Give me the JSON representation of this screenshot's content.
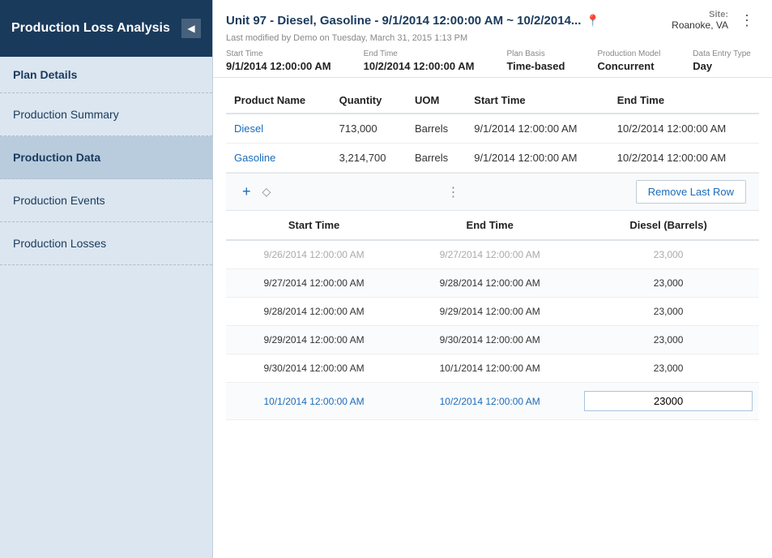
{
  "sidebar": {
    "title": "Production Loss Analysis",
    "plan_details_label": "Plan Details",
    "items": [
      {
        "id": "production-summary",
        "label": "Production Summary",
        "active": false
      },
      {
        "id": "production-data",
        "label": "Production Data",
        "active": true
      },
      {
        "id": "production-events",
        "label": "Production Events",
        "active": false
      },
      {
        "id": "production-losses",
        "label": "Production Losses",
        "active": false
      }
    ]
  },
  "header": {
    "title": "Unit 97 - Diesel, Gasoline - 9/1/2014 12:00:00 AM ~ 10/2/2014...",
    "subtitle": "Last modified by Demo on Tuesday, March 31, 2015 1:13 PM",
    "site_label": "Site:",
    "site_value": "Roanoke, VA",
    "meta": [
      {
        "label": "Start Time",
        "value": "9/1/2014 12:00:00 AM"
      },
      {
        "label": "End Time",
        "value": "10/2/2014 12:00:00 AM"
      },
      {
        "label": "Plan Basis",
        "value": "Time-based"
      },
      {
        "label": "Production Model",
        "value": "Concurrent"
      },
      {
        "label": "Data Entry Type",
        "value": "Day"
      }
    ]
  },
  "product_table": {
    "columns": [
      "Product Name",
      "Quantity",
      "UOM",
      "Start Time",
      "End Time"
    ],
    "rows": [
      {
        "product": "Diesel",
        "quantity": "713,000",
        "uom": "Barrels",
        "start_time": "9/1/2014 12:00:00 AM",
        "end_time": "10/2/2014 12:00:00 AM"
      },
      {
        "product": "Gasoline",
        "quantity": "3,214,700",
        "uom": "Barrels",
        "start_time": "9/1/2014 12:00:00 AM",
        "end_time": "10/2/2014 12:00:00 AM"
      }
    ]
  },
  "toolbar": {
    "add_icon": "+",
    "sort_icon": "⬡",
    "more_icon": "⋮",
    "remove_last_label": "Remove Last Row"
  },
  "data_table": {
    "columns": [
      "Start Time",
      "End Time",
      "Diesel (Barrels)"
    ],
    "rows": [
      {
        "start": "9/26/2014 12:00:00 AM",
        "end": "9/27/2014 12:00:00 AM",
        "value": "23,000",
        "faded": true
      },
      {
        "start": "9/27/2014 12:00:00 AM",
        "end": "9/28/2014 12:00:00 AM",
        "value": "23,000",
        "faded": false
      },
      {
        "start": "9/28/2014 12:00:00 AM",
        "end": "9/29/2014 12:00:00 AM",
        "value": "23,000",
        "faded": false
      },
      {
        "start": "9/29/2014 12:00:00 AM",
        "end": "9/30/2014 12:00:00 AM",
        "value": "23,000",
        "faded": false
      },
      {
        "start": "9/30/2014 12:00:00 AM",
        "end": "10/1/2014 12:00:00 AM",
        "value": "23,000",
        "faded": false
      },
      {
        "start": "10/1/2014 12:00:00 AM",
        "end": "10/2/2014 12:00:00 AM",
        "value": "23000",
        "highlighted": true,
        "editable": true
      }
    ]
  }
}
